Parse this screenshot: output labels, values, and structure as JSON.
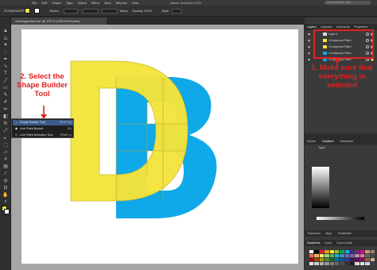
{
  "app": {
    "title": "Adobe Illustrator 2021",
    "menu": [
      "File",
      "Edit",
      "Object",
      "Type",
      "Select",
      "Effect",
      "View",
      "Window",
      "Help"
    ],
    "search_placeholder": "Search Adobe Help"
  },
  "control_bar": {
    "selection_label": "Compound Path",
    "stroke_label": "Stroke:",
    "brush_label": "Basic",
    "opacity_label": "Opacity:",
    "opacity_value": "100%",
    "style_label": "Style:",
    "fill_color": "#f5e43a",
    "stroke_color": "#ffffff"
  },
  "document": {
    "tab_label": "Overlappedtext.ai* @ 200 % (CMYK/Preview)"
  },
  "tools": {
    "icons": [
      "selection-icon",
      "direct-selection-icon",
      "magic-wand-icon",
      "lasso-icon",
      "pen-icon",
      "curvature-icon",
      "type-icon",
      "line-icon",
      "rectangle-icon",
      "paintbrush-icon",
      "shaper-icon",
      "pencil-icon",
      "eraser-icon",
      "rotate-icon",
      "scale-icon",
      "width-icon",
      "free-transform-icon",
      "shape-builder-icon",
      "perspective-icon",
      "mesh-icon",
      "gradient-icon",
      "eyedropper-icon",
      "blend-icon",
      "symbol-sprayer-icon",
      "column-graph-icon",
      "artboard-icon",
      "slice-icon",
      "hand-icon",
      "zoom-icon"
    ],
    "flyout": [
      {
        "label": "Shape Builder Tool",
        "shortcut": "(Shift+M)",
        "icon": "shape-builder-icon",
        "selected": true
      },
      {
        "label": "Live Paint Bucket",
        "shortcut": "(K)",
        "icon": "paint-bucket-icon",
        "selected": false
      },
      {
        "label": "Live Paint Selection Tool",
        "shortcut": "(Shift+L)",
        "icon": "live-paint-selection-icon",
        "selected": false
      }
    ]
  },
  "annotations": {
    "step2": "2. Select the Shape Builder Tool",
    "step1": "1. Make sure that everything is selected"
  },
  "layers_panel": {
    "tabs": [
      "Layers",
      "Libraries",
      "Artboards",
      "Properties"
    ],
    "rows": [
      {
        "name": "Layer 1"
      },
      {
        "name": "<Compound Path>"
      },
      {
        "name": "<Compound Path>"
      },
      {
        "name": "<Compound Path>"
      },
      {
        "name": "<Compound Path>"
      }
    ]
  },
  "lower_panels": {
    "stroke_tab": "Stroke",
    "gradient_tab": "Gradient",
    "transform_tab": "Transform",
    "gradient_type_label": "Type:",
    "swatches_tabs": [
      "Swatches",
      "Color",
      "Color Guide"
    ],
    "appearance_tabs": [
      "Transform",
      "Align",
      "Pathfinder"
    ]
  },
  "colors": {
    "yellow": "#f5e43a",
    "blue": "#0fa8e8",
    "annotation_red": "#e02020",
    "swatches": [
      "#ffffff",
      "#000000",
      "#ed1c24",
      "#f7941d",
      "#fff200",
      "#8dc63f",
      "#00a651",
      "#00aeef",
      "#2e3192",
      "#662d91",
      "#ec008c",
      "#c69c6d",
      "#998675",
      "#f26c4f",
      "#fbaf5d",
      "#fff568",
      "#acd373",
      "#3cb878",
      "#1cbbb4",
      "#448ccb",
      "#5674b9",
      "#8560a8",
      "#bd8cbf",
      "#f06eaa",
      "#736357",
      "#534741",
      "#9e0b0f",
      "#a0410d",
      "#aba000",
      "#598527",
      "#007236",
      "#0076a3",
      "#0054a6",
      "#21409a",
      "#440e62",
      "#630460",
      "#9e005d",
      "#8c6239",
      "#c7b299",
      "#e6e6e6",
      "#cccccc",
      "#b3b3b3",
      "#999999",
      "#808080",
      "#666666",
      "#4d4d4d",
      "#333333",
      "#1a1a1a",
      "#f0d0d0",
      "#d0f0d0",
      "#d0d0f0",
      "#404040"
    ]
  }
}
